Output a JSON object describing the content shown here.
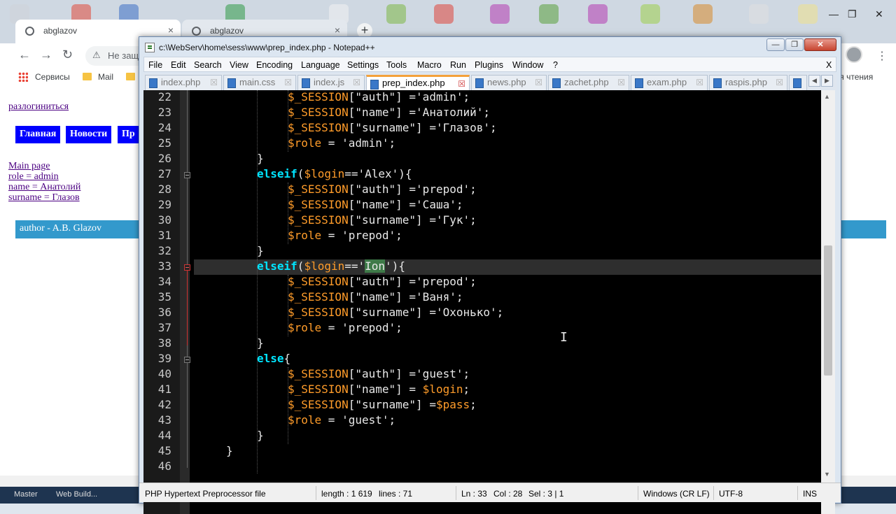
{
  "browser": {
    "tabs": [
      {
        "title": "abglazov"
      },
      {
        "title": "abglazov"
      }
    ],
    "omnibox_text": "Не защ",
    "bookmarks": {
      "apps": "Сервисы",
      "mail": "Mail",
      "reading_list": "Список для чтения"
    },
    "page": {
      "logout_link": "разлогиниться",
      "nav": [
        "Главная",
        "Новости",
        "Пр"
      ],
      "info_links": [
        "Main page",
        "role = admin",
        "name = Анатолий",
        "surname = Глазов"
      ],
      "author": "author - A.B. Glazov"
    },
    "taskbar": [
      "Master",
      "Web Build..."
    ]
  },
  "npp": {
    "title": "c:\\WebServ\\home\\sess\\www\\prep_index.php - Notepad++",
    "menu": [
      "File",
      "Edit",
      "Search",
      "View",
      "Encoding",
      "Language",
      "Settings",
      "Tools",
      "Macro",
      "Run",
      "Plugins",
      "Window",
      "?"
    ],
    "menu_close": "X",
    "tabs": [
      {
        "name": "index.php",
        "active": false
      },
      {
        "name": "main.css",
        "active": false
      },
      {
        "name": "index.js",
        "active": false
      },
      {
        "name": "prep_index.php",
        "active": true
      },
      {
        "name": "news.php",
        "active": false
      },
      {
        "name": "zachet.php",
        "active": false
      },
      {
        "name": "exam.php",
        "active": false
      },
      {
        "name": "raspis.php",
        "active": false
      }
    ],
    "status": {
      "filetype": "PHP Hypertext Preprocessor file",
      "length": "length : 1 619",
      "lines": "lines : 71",
      "ln": "Ln : 33",
      "col": "Col : 28",
      "sel": "Sel : 3 | 1",
      "eol": "Windows (CR LF)",
      "encoding": "UTF-8",
      "mode": "INS"
    },
    "line_numbers": [
      "22",
      "23",
      "24",
      "25",
      "26",
      "27",
      "28",
      "29",
      "30",
      "31",
      "32",
      "33",
      "34",
      "35",
      "36",
      "37",
      "38",
      "39",
      "40",
      "41",
      "42",
      "43",
      "44",
      "45",
      "46"
    ],
    "current_line": "33",
    "selected_text": "Ion"
  }
}
